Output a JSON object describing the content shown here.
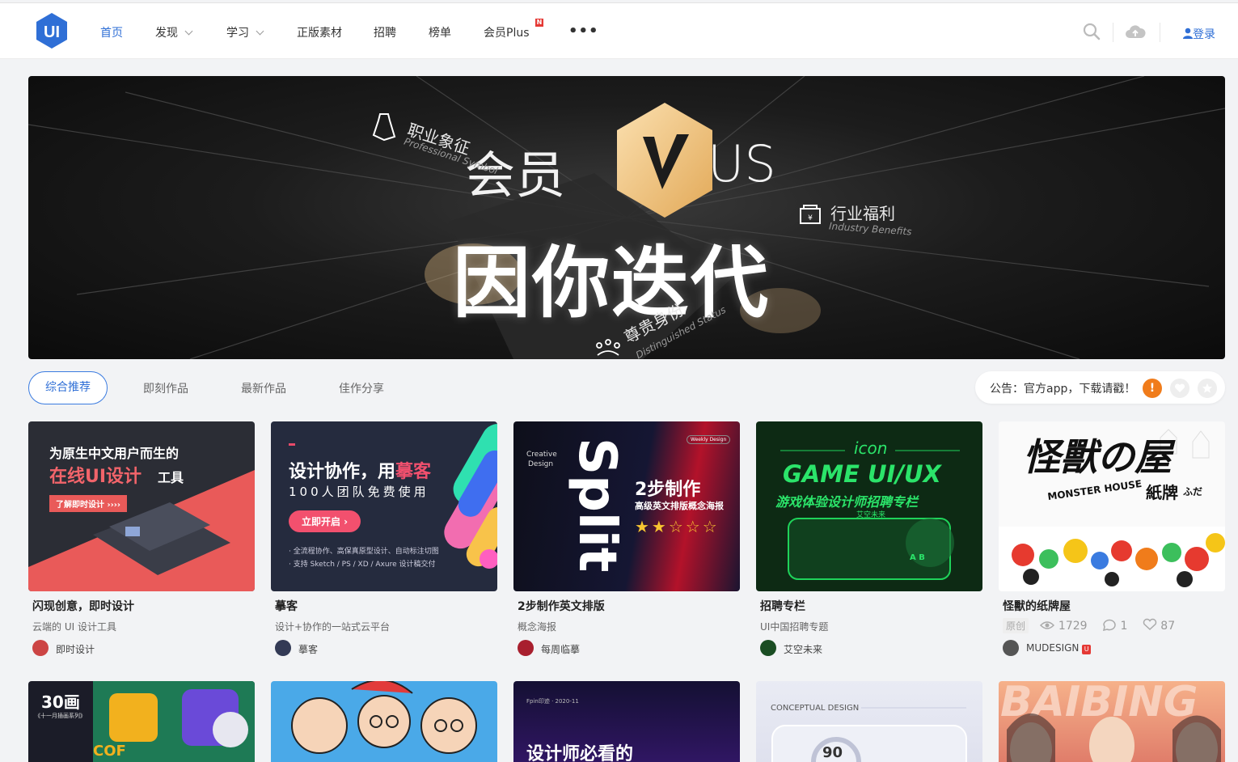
{
  "header": {
    "logo_text": "UI",
    "nav": [
      {
        "label": "首页"
      },
      {
        "label": "发现"
      },
      {
        "label": "学习"
      },
      {
        "label": "正版素材"
      },
      {
        "label": "招聘"
      },
      {
        "label": "榜单"
      },
      {
        "label": "会员Plus"
      }
    ],
    "new_badge": "N",
    "more": "•••",
    "login": "登录"
  },
  "banner": {
    "vip_left": "会员",
    "vip_right": "US",
    "main": "因你迭代",
    "tags": [
      {
        "cn": "职业象征",
        "en": "Professional Symbol"
      },
      {
        "cn": "行业福利",
        "en": "Industry Benefits"
      },
      {
        "cn": "尊贵身份",
        "en": "Distinguished Status"
      }
    ]
  },
  "tabs": [
    "综合推荐",
    "即刻作品",
    "最新作品",
    "佳作分享"
  ],
  "notice": {
    "text": "公告：官方app，下载请戳！",
    "alert_icon": "!"
  },
  "cards": [
    {
      "title": "闪现创意，即时设计",
      "subtitle": "云端的 UI 设计工具",
      "author": "即时设计",
      "img_line1": "为原生中文用户而生的",
      "img_line2": "在线UI设计",
      "img_line2b": "工具",
      "img_btn": "了解即时设计 ››››"
    },
    {
      "title": "摹客",
      "subtitle": "设计+协作的一站式云平台",
      "author": "摹客",
      "img_line1": "设计协作，用",
      "img_line1b": "摹客",
      "img_line2": "100人团队免费使用",
      "img_btn": "立即开启 ›",
      "img_b1": "· 全流程协作、高保真原型设计、自动标注切图",
      "img_b2": "· 支持 Sketch / PS / XD / Axure 设计稿交付"
    },
    {
      "title": "2步制作英文排版",
      "subtitle": "概念海报",
      "author": "每周临摹",
      "img_split": "Split",
      "img_creative": "Creative",
      "img_design": "Design",
      "img_line1": "2步制作",
      "img_line2": "高级英文排版概念海报",
      "img_tag": "Weekly Design",
      "img_stars": "★★☆☆☆"
    },
    {
      "title": "招聘专栏",
      "subtitle": "UI中国招聘专题",
      "author": "艾空未来",
      "img_icon": "icon",
      "img_line1": "GAME UI/UX",
      "img_line2": "游戏体验设计师招聘专栏",
      "img_line3": "艾空未来",
      "img_keys": "A  B"
    },
    {
      "title": "怪獸的纸牌屋",
      "author": "MUDESIGN",
      "orig": "原创",
      "views": "1729",
      "comments": "1",
      "likes": "87",
      "img_line1": "怪獸の屋",
      "img_line2": "MONSTER HOUSE",
      "img_line3": "紙牌",
      "img_line3b": "ふだ"
    }
  ],
  "row2": [
    {
      "text": "30画",
      "sub": "《十一月插画系列》",
      "word": "COF"
    },
    {
      "text": ""
    },
    {
      "text": "设计师必看的",
      "sub": "Fpin印迹 · 2020-11"
    },
    {
      "text": "CONCEPTUAL DESIGN",
      "sub": "90"
    },
    {
      "text": "BAIBING"
    }
  ],
  "colors": {
    "accent": "#2f6fd6",
    "notice_alert": "#f07c1b",
    "logo": "#2f6fd6"
  }
}
